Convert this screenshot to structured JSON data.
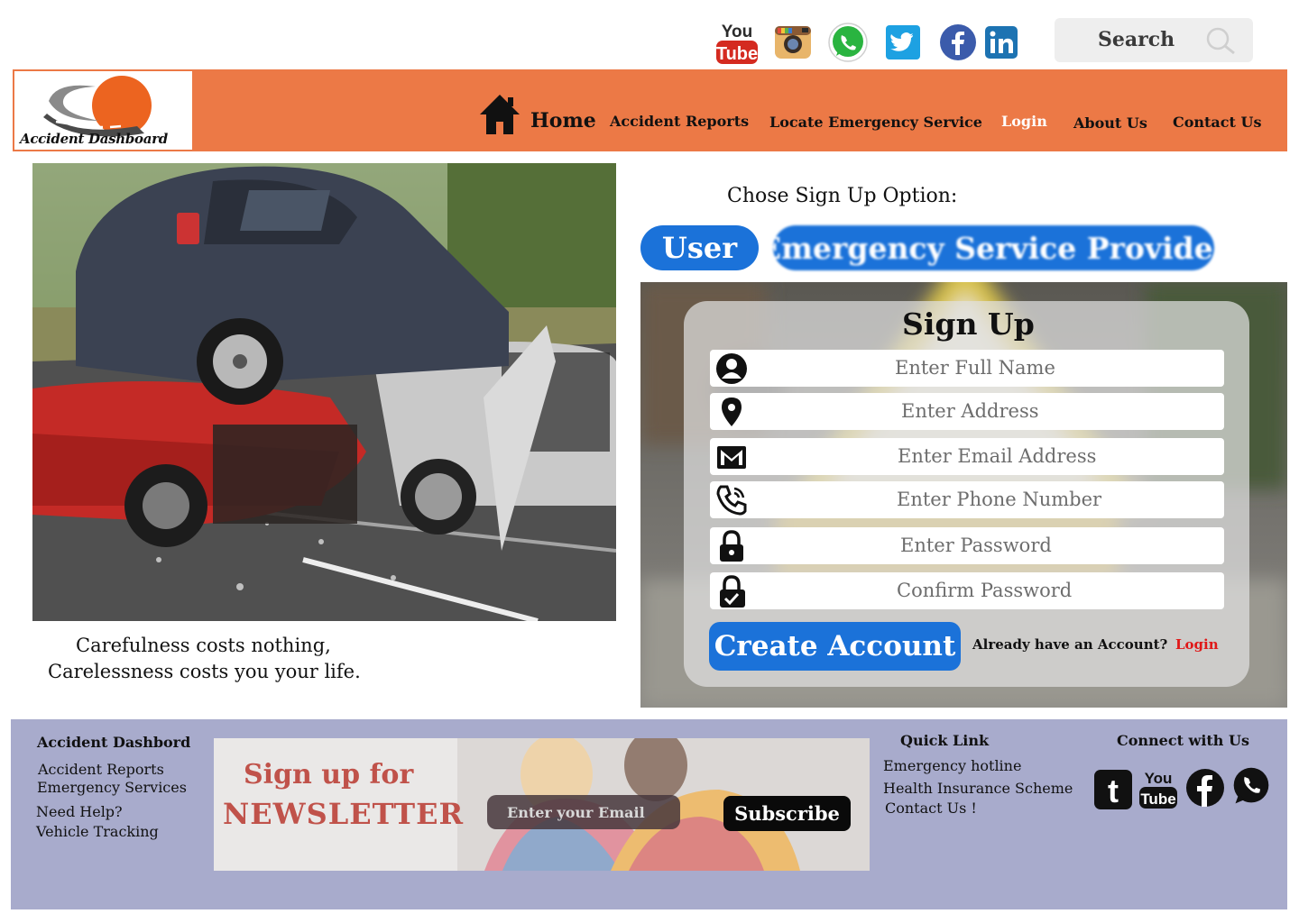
{
  "social_top": {
    "icons": [
      "youtube-icon",
      "instagram-icon",
      "whatsapp-icon",
      "twitter-icon",
      "facebook-icon",
      "linkedin-icon"
    ],
    "youtube_you": "You",
    "youtube_tube": "Tube"
  },
  "search": {
    "label": "Search"
  },
  "header": {
    "logo_text": "Accident Dashboard",
    "nav": {
      "home": "Home",
      "accident_reports": "Accident Reports",
      "locate": "Locate Emergency Service",
      "login": "Login",
      "about": "About Us",
      "contact": "Contact Us"
    },
    "active_color": "#ffffff",
    "bg_color": "#ec7946"
  },
  "hero": {
    "caption_line1": "Carefulness costs nothing,",
    "caption_line2": "Carelessness costs you your life."
  },
  "signup_option": {
    "title": "Chose Sign Up Option:",
    "user": "User",
    "esp": "Emergency Service Provider",
    "accent": "#1b72d9"
  },
  "signup": {
    "title": "Sign Up",
    "fields": [
      {
        "icon": "person-icon",
        "placeholder": "Enter Full Name"
      },
      {
        "icon": "location-pin-icon",
        "placeholder": "Enter Address"
      },
      {
        "icon": "mail-icon",
        "placeholder": "Enter Email Address"
      },
      {
        "icon": "phone-icon",
        "placeholder": "Enter Phone Number"
      },
      {
        "icon": "lock-icon",
        "placeholder": "Enter Password"
      },
      {
        "icon": "lock-check-icon",
        "placeholder": "Confirm Password"
      }
    ],
    "create_button": "Create Account",
    "already": "Already have an Account?",
    "login": "Login"
  },
  "footer": {
    "brand": "Accident Dashbord",
    "links_left": [
      "Accident Reports",
      "Emergency Services",
      "Need Help?",
      "Vehicle Tracking"
    ],
    "newsletter": {
      "line1": "Sign up for",
      "line2": "NEWSLETTER",
      "placeholder": "Enter your Email",
      "subscribe": "Subscribe"
    },
    "quick_link_title": "Quick Link",
    "quick_links": [
      "Emergency hotline",
      "Health Insurance Scheme",
      "Contact Us !"
    ],
    "connect_title": "Connect with Us",
    "connect_icons": [
      "tumblr-icon",
      "youtube-icon",
      "facebook-icon",
      "whatsapp-icon"
    ],
    "yt_you": "You",
    "yt_tube": "Tube",
    "tumblr_letter": "t"
  }
}
